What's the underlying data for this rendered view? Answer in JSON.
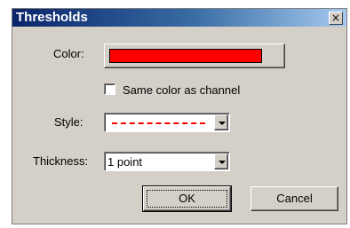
{
  "window": {
    "title": "Thresholds",
    "close_glyph": "×"
  },
  "color": {
    "label": "Color:",
    "value": "#ff0000"
  },
  "same_color": {
    "label": "Same color as channel",
    "checked": false
  },
  "style": {
    "label": "Style:",
    "selected": "dashed",
    "line_color": "#ff0000"
  },
  "thickness": {
    "label": "Thickness:",
    "selected": "1 point"
  },
  "buttons": {
    "ok": "OK",
    "cancel": "Cancel"
  }
}
